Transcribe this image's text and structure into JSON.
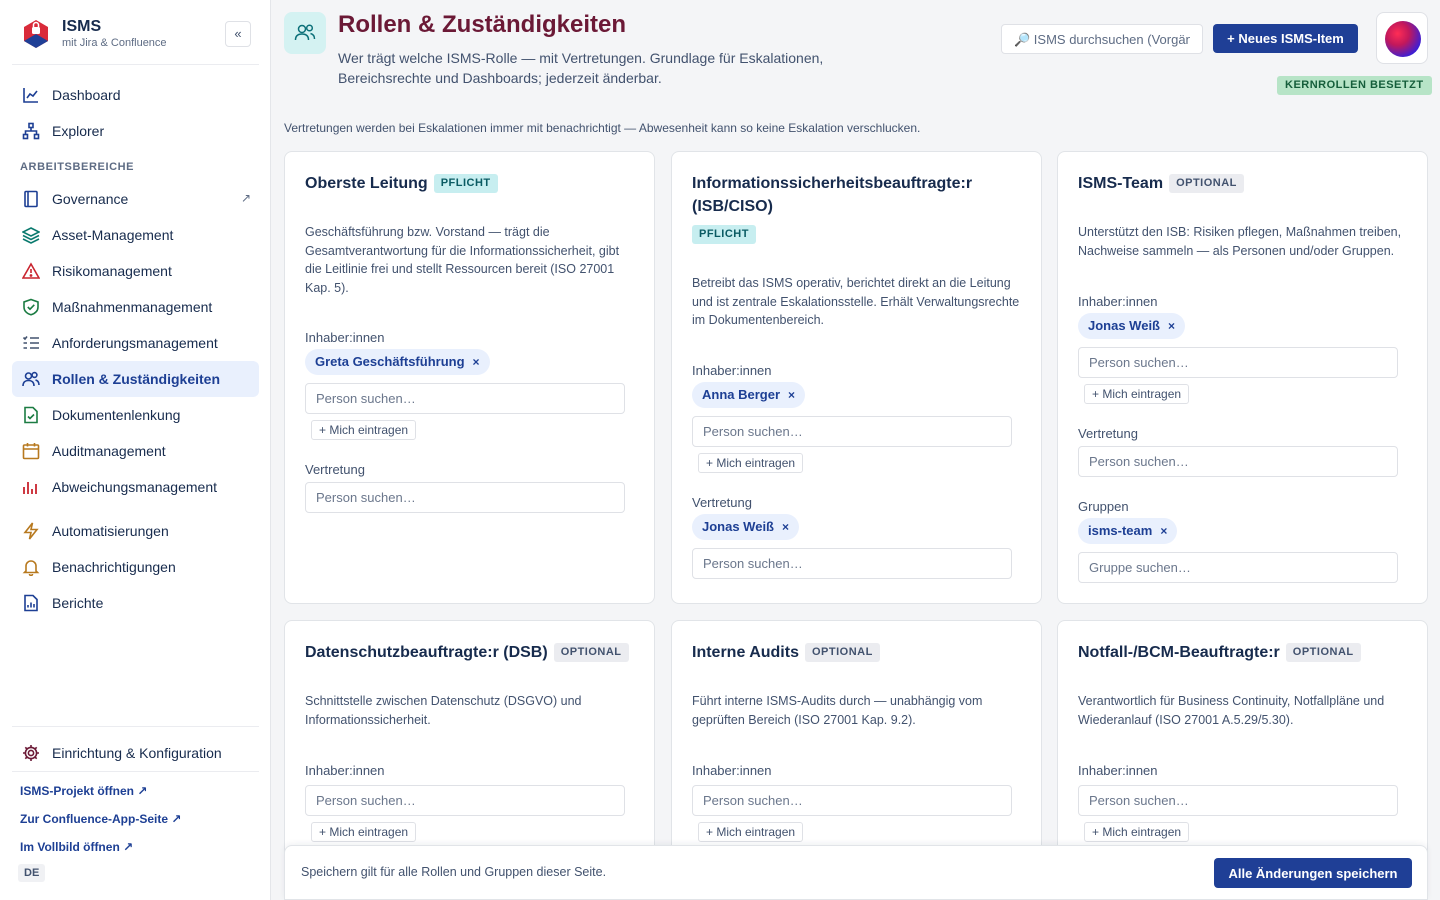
{
  "brand": {
    "title": "ISMS",
    "subtitle": "mit Jira & Confluence",
    "collapse": "«"
  },
  "sidebar": {
    "nav": [
      {
        "label": "Dashboard",
        "icon": "chart-line-icon"
      },
      {
        "label": "Explorer",
        "icon": "hierarchy-icon"
      }
    ],
    "section_label": "ARBEITSBEREICHE",
    "workspaces": [
      {
        "label": "Governance",
        "icon": "book-icon",
        "ext": "↗"
      },
      {
        "label": "Asset-Management",
        "icon": "layers-icon"
      },
      {
        "label": "Risikomanagement",
        "icon": "warning-triangle-icon"
      },
      {
        "label": "Maßnahmenmanagement",
        "icon": "shield-check-icon"
      },
      {
        "label": "Anforderungsmanagement",
        "icon": "checklist-icon"
      },
      {
        "label": "Rollen & Zuständigkeiten",
        "icon": "users-icon",
        "active": true
      },
      {
        "label": "Dokumentenlenkung",
        "icon": "document-check-icon"
      },
      {
        "label": "Auditmanagement",
        "icon": "calendar-icon"
      },
      {
        "label": "Abweichungsmanagement",
        "icon": "bar-chart-icon"
      }
    ],
    "tools": [
      {
        "label": "Automatisierungen",
        "icon": "lightning-icon"
      },
      {
        "label": "Benachrichtigungen",
        "icon": "bell-icon"
      },
      {
        "label": "Berichte",
        "icon": "report-icon"
      }
    ],
    "settings": {
      "label": "Einrichtung & Konfiguration",
      "icon": "gear-icon"
    },
    "links": [
      {
        "label": "ISMS-Projekt öffnen ↗"
      },
      {
        "label": "Zur Confluence-App-Seite ↗"
      },
      {
        "label": "Im Vollbild öffnen ↗"
      }
    ],
    "lang": "DE"
  },
  "header": {
    "title": "Rollen & Zuständigkeiten",
    "description": "Wer trägt welche ISMS-Rolle — mit Vertretungen. Grundlage für Eskalationen, Bereichsrechte und Dashboards; jederzeit änderbar.",
    "search_placeholder": "🔎 ISMS durchsuchen (Vorgänge, Seiten)",
    "new_button": "+ Neues ISMS-Item",
    "status_badge": "KERNROLLEN BESETZT"
  },
  "info_note": "Vertretungen werden bei Eskalationen immer mit benachrichtigt — Abwesenheit kann so keine Eskalation verschlucken.",
  "labels": {
    "owners": "Inhaber:innen",
    "deputy": "Vertretung",
    "groups": "Gruppen",
    "person_placeholder": "Person suchen…",
    "group_placeholder": "Gruppe suchen…",
    "add_me": "+ Mich eintragen",
    "remove": "×"
  },
  "cards": [
    {
      "title": "Oberste Leitung",
      "badge": "PFLICHT",
      "description": "Geschäftsführung bzw. Vorstand — trägt die Gesamtverantwortung für die Informationssicherheit, gibt die Leitlinie frei und stellt Ressourcen bereit (ISO 27001 Kap. 5).",
      "owners": [
        "Greta Geschäftsführung"
      ],
      "deputies": []
    },
    {
      "title": "Informationssicherheitsbeauftragte:r (ISB/CISO)",
      "badge": "PFLICHT",
      "description": "Betreibt das ISMS operativ, berichtet direkt an die Leitung und ist zentrale Eskalationsstelle. Erhält Verwaltungsrechte im Dokumentenbereich.",
      "owners": [
        "Anna Berger"
      ],
      "deputies": [
        "Jonas Weiß"
      ]
    },
    {
      "title": "ISMS-Team",
      "badge": "OPTIONAL",
      "description": "Unterstützt den ISB: Risiken pflegen, Maßnahmen treiben, Nachweise sammeln — als Personen und/oder Gruppen.",
      "owners": [
        "Jonas Weiß"
      ],
      "deputies": [],
      "groups": [
        "isms-team"
      ]
    },
    {
      "title": "Datenschutzbeauftragte:r (DSB)",
      "badge": "OPTIONAL",
      "description": "Schnittstelle zwischen Datenschutz (DSGVO) und Informationssicherheit."
    },
    {
      "title": "Interne Audits",
      "badge": "OPTIONAL",
      "description": "Führt interne ISMS-Audits durch — unabhängig vom geprüften Bereich (ISO 27001 Kap. 9.2)."
    },
    {
      "title": "Notfall-/BCM-Beauftragte:r",
      "badge": "OPTIONAL",
      "description": "Verantwortlich für Business Continuity, Notfallpläne und Wiederanlauf (ISO 27001 A.5.29/5.30)."
    }
  ],
  "save_bar": {
    "note": "Speichern gilt für alle Rollen und Gruppen dieser Seite.",
    "button": "Alle Änderungen speichern"
  },
  "colors": {
    "accent": "#1f3f96",
    "title": "#6b1936",
    "active_bg": "#e9f0fd",
    "ok_badge": "#b7e4c7"
  }
}
